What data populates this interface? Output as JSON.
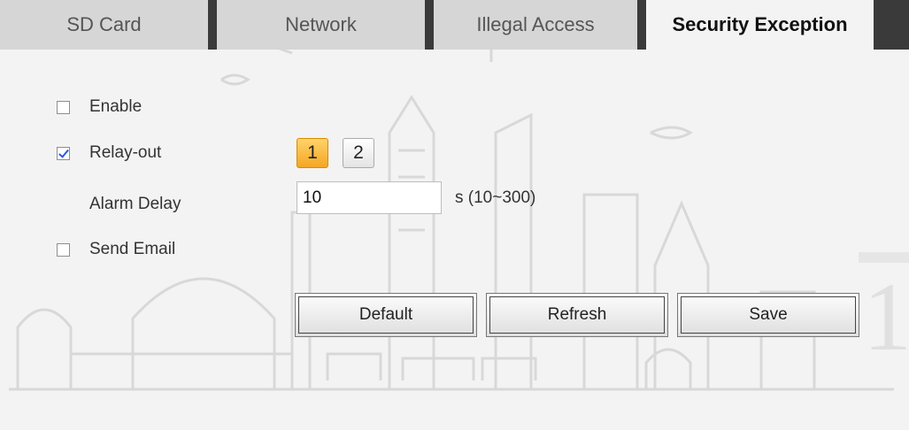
{
  "tabs": [
    {
      "label": "SD Card",
      "active": false
    },
    {
      "label": "Network",
      "active": false
    },
    {
      "label": "Illegal Access",
      "active": false
    },
    {
      "label": "Security Exception",
      "active": true
    }
  ],
  "form": {
    "enable": {
      "label": "Enable",
      "checked": false
    },
    "relay_out": {
      "label": "Relay-out",
      "checked": true,
      "buttons": [
        "1",
        "2"
      ],
      "selected": "1"
    },
    "alarm_delay": {
      "label": "Alarm Delay",
      "value": "10",
      "unit_hint": "s (10~300)"
    },
    "send_email": {
      "label": "Send Email",
      "checked": false
    }
  },
  "buttons": {
    "default_label": "Default",
    "refresh_label": "Refresh",
    "save_label": "Save"
  },
  "colors": {
    "accent_active": "#f5a623",
    "tab_separator": "#3a3a3a",
    "background": "#f3f3f3"
  }
}
